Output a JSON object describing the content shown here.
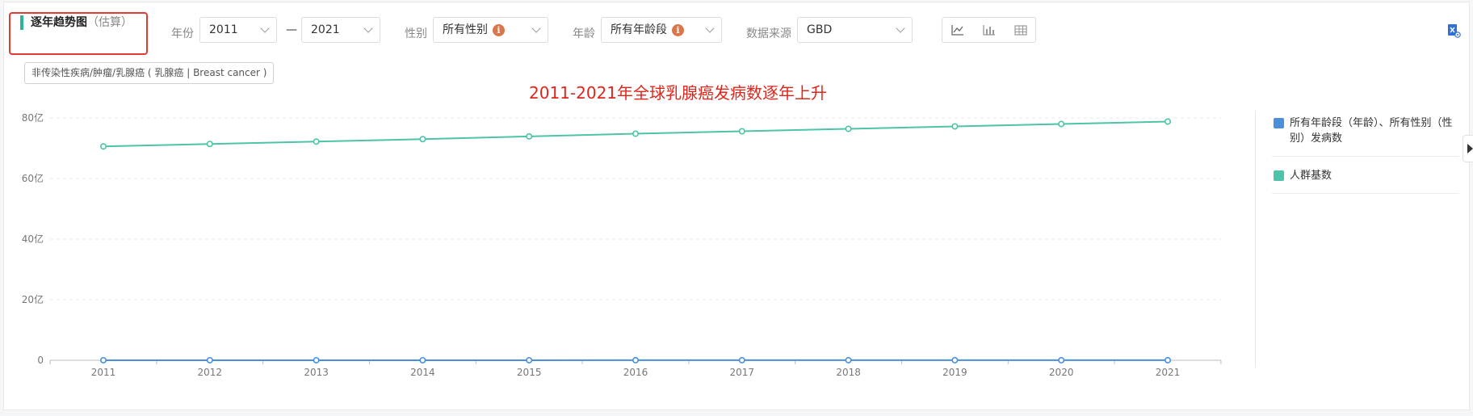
{
  "header": {
    "title": "逐年趋势图",
    "title_suffix": "（估算）"
  },
  "filters": {
    "year_label": "年份",
    "year_from": "2011",
    "year_sep": "—",
    "year_to": "2021",
    "sex_label": "性别",
    "sex_value": "所有性别",
    "age_label": "年龄",
    "age_value": "所有年龄段",
    "source_label": "数据来源",
    "source_value": "GBD",
    "info_glyph": "i"
  },
  "tag": "非传染性疾病/肿瘤/乳腺癌 ( 乳腺癌 | Breast cancer )",
  "annotation": "2011-2021年全球乳腺癌发病数逐年上升",
  "legend": {
    "items": [
      {
        "label": "所有年龄段（年龄）、所有性别（性别）发病数",
        "color": "#4a90d9"
      },
      {
        "label": "人群基数",
        "color": "#4dc4a8"
      }
    ]
  },
  "colors": {
    "incidence": "#4a90d9",
    "population": "#4dc4a8",
    "highlight": "#e53935",
    "annotation": "#e0261b"
  },
  "chart_data": {
    "type": "line",
    "x": [
      "2011",
      "2012",
      "2013",
      "2014",
      "2015",
      "2016",
      "2017",
      "2018",
      "2019",
      "2020",
      "2021"
    ],
    "y_tick_labels": [
      "0",
      "20亿",
      "40亿",
      "60亿",
      "80亿"
    ],
    "y_tick_values": [
      0,
      20,
      40,
      60,
      80
    ],
    "ylim": [
      0,
      80
    ],
    "grid": true,
    "legend_position": "right",
    "series": [
      {
        "name": "所有年龄段（年龄）、所有性别（性别）发病数",
        "values": [
          0.013,
          0.014,
          0.014,
          0.015,
          0.016,
          0.017,
          0.017,
          0.018,
          0.019,
          0.019,
          0.02
        ]
      },
      {
        "name": "人群基数",
        "values": [
          70.6,
          71.4,
          72.2,
          73.0,
          73.9,
          74.8,
          75.6,
          76.4,
          77.2,
          78.0,
          78.8
        ]
      }
    ]
  }
}
